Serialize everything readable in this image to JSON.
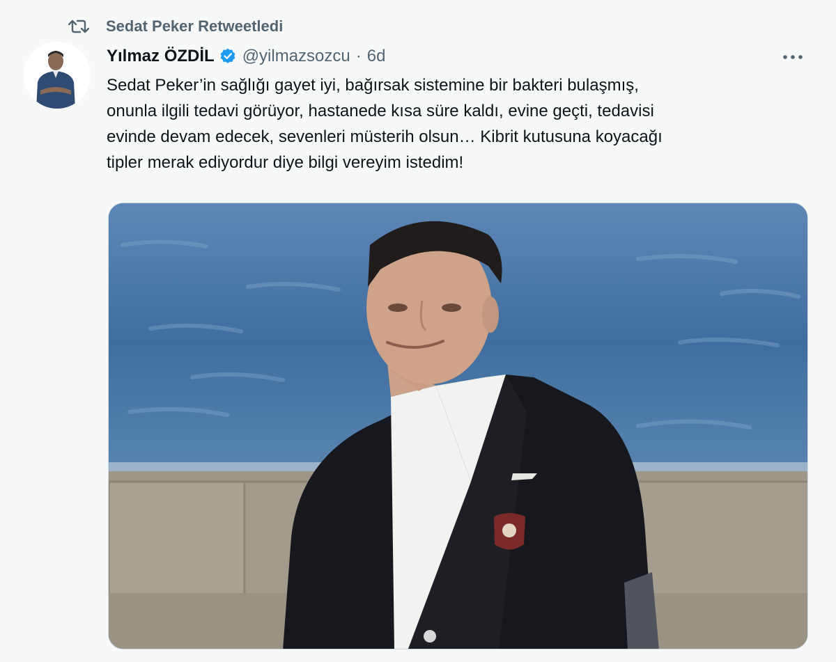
{
  "retweet_context": {
    "text": "Sedat Peker Retweetledi",
    "icon": "retweet-icon"
  },
  "tweet": {
    "display_name": "Yılmaz ÖZDİL",
    "verified": true,
    "handle": "@yilmazsozcu",
    "separator": "·",
    "time": "6d",
    "more_icon": "more-horizontal-icon",
    "text": "Sedat Peker’in sağlığı gayet iyi, bağırsak sistemine bir bakteri bulaşmış,\nonunla ilgili tedavi görüyor, hastanede kısa süre kaldı, evine geçti, tedavisi\nevinde devam edecek, sevenleri müsterih olsun… Kibrit kutusuna koyacağı\ntipler merak ediyordur diye bilgi vereyim istedim!"
  },
  "colors": {
    "background": "#f7f9f9",
    "text_primary": "#0f1419",
    "text_secondary": "#536471",
    "verified_blue": "#1d9bf0"
  }
}
